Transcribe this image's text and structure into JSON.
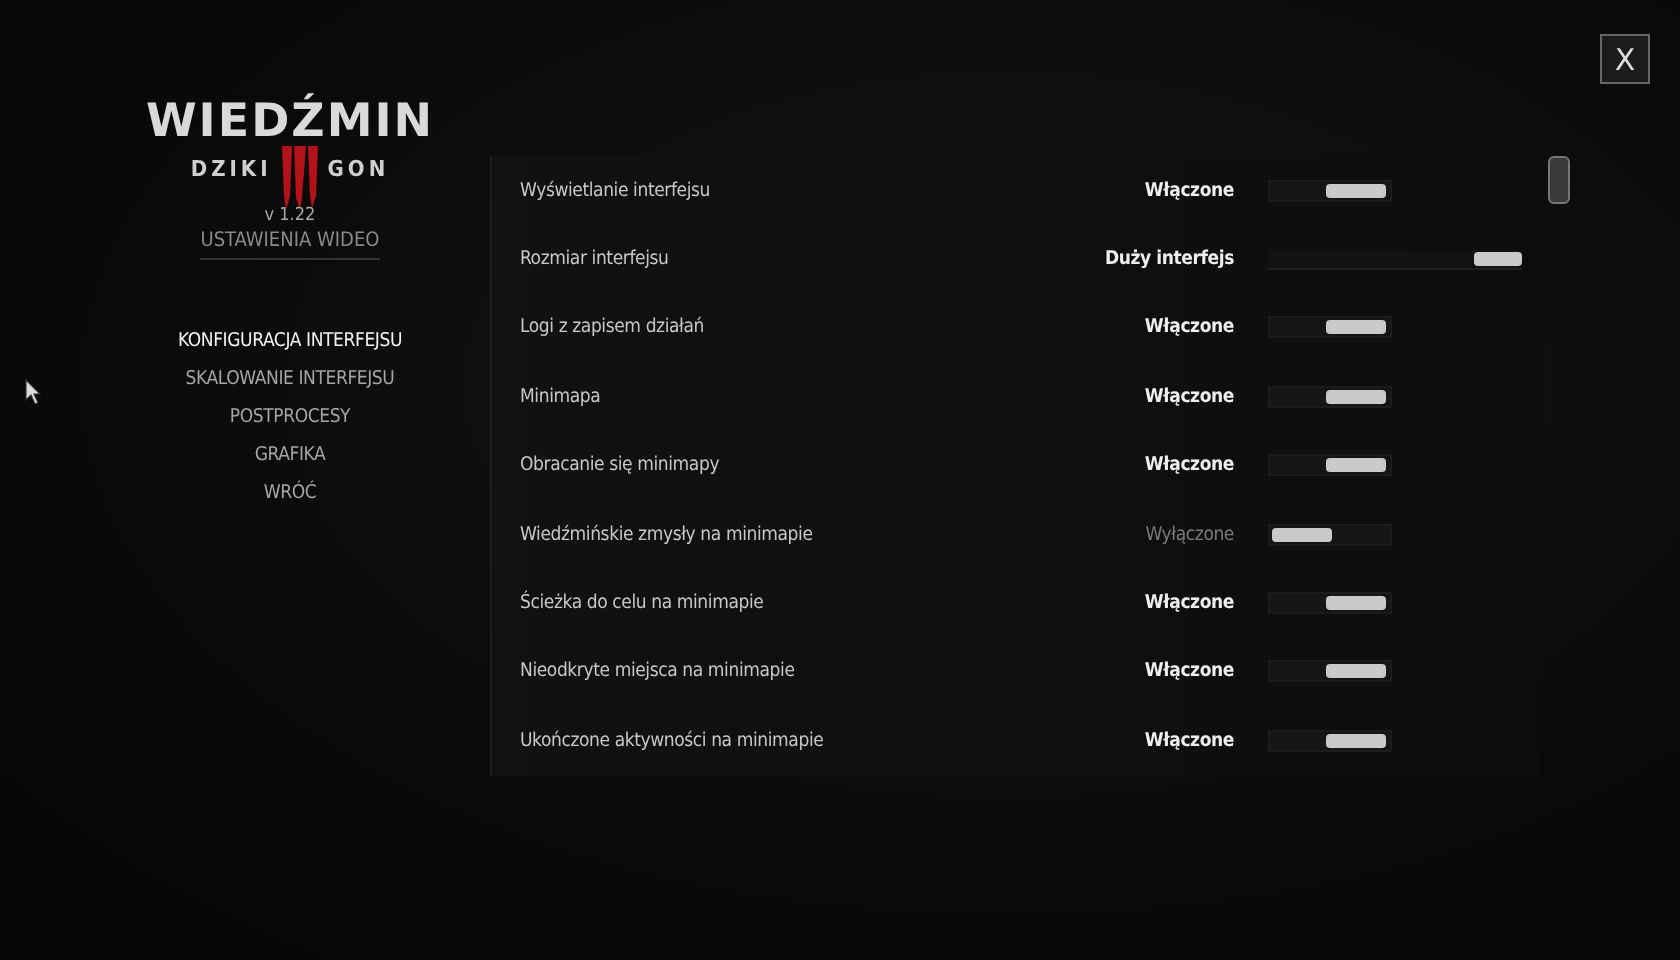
{
  "logo": {
    "title": "WIEDŹMIN",
    "subtitle_left": "DZIKI",
    "subtitle_right": "GON"
  },
  "version": "v 1.22",
  "section_title": "USTAWIENIA WIDEO",
  "menu": [
    {
      "label": "KONFIGURACJA INTERFEJSU",
      "selected": true
    },
    {
      "label": "SKALOWANIE INTERFEJSU",
      "selected": false
    },
    {
      "label": "POSTPROCESY",
      "selected": false
    },
    {
      "label": "GRAFIKA",
      "selected": false
    },
    {
      "label": "WRÓĆ",
      "selected": false
    }
  ],
  "close_button": "X",
  "settings": [
    {
      "label": "Wyświetlanie interfejsu",
      "value": "Włączone",
      "kind": "toggle",
      "on": true
    },
    {
      "label": "Rozmiar interfejsu",
      "value": "Duży interfejs",
      "kind": "slider",
      "level": 1
    },
    {
      "label": "Logi z zapisem działań",
      "value": "Włączone",
      "kind": "toggle",
      "on": true
    },
    {
      "label": "Minimapa",
      "value": "Włączone",
      "kind": "toggle",
      "on": true
    },
    {
      "label": "Obracanie się minimapy",
      "value": "Włączone",
      "kind": "toggle",
      "on": true
    },
    {
      "label": "Wiedźmińskie zmysły na minimapie",
      "value": "Wyłączone",
      "kind": "toggle",
      "on": false
    },
    {
      "label": "Ścieżka do celu na minimapie",
      "value": "Włączone",
      "kind": "toggle",
      "on": true
    },
    {
      "label": "Nieodkryte miejsca na minimapie",
      "value": "Włączone",
      "kind": "toggle",
      "on": true
    },
    {
      "label": "Ukończone aktywności na minimapie",
      "value": "Włączone",
      "kind": "toggle",
      "on": true
    }
  ]
}
